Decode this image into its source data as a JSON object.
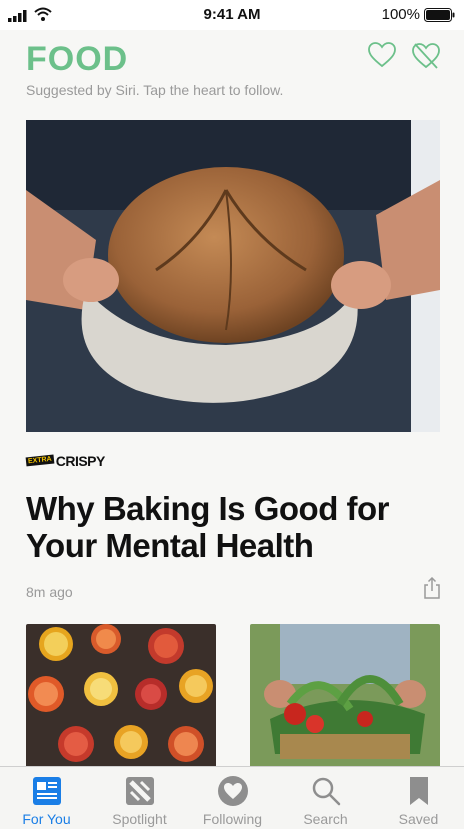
{
  "status_bar": {
    "time": "9:41 AM",
    "battery_percent": "100%"
  },
  "header": {
    "title": "FOOD",
    "subtitle": "Suggested by Siri. Tap the heart to follow."
  },
  "article": {
    "source": "CRISPY",
    "source_tag": "EXTRA",
    "headline": "Why Baking Is Good for Your Mental Health",
    "time_ago": "8m ago"
  },
  "icons": {
    "follow": "heart-outline-icon",
    "block": "heart-slash-icon",
    "share": "share-icon"
  },
  "tabs": [
    {
      "label": "For You",
      "icon": "news-icon",
      "active": true
    },
    {
      "label": "Spotlight",
      "icon": "spotlight-icon",
      "active": false
    },
    {
      "label": "Following",
      "icon": "heart-icon",
      "active": false
    },
    {
      "label": "Search",
      "icon": "search-icon",
      "active": false
    },
    {
      "label": "Saved",
      "icon": "bookmark-icon",
      "active": false
    }
  ],
  "colors": {
    "accent": "#6cc08a",
    "tab_active": "#1a7ee6",
    "tab_inactive": "#9a9a9a"
  }
}
